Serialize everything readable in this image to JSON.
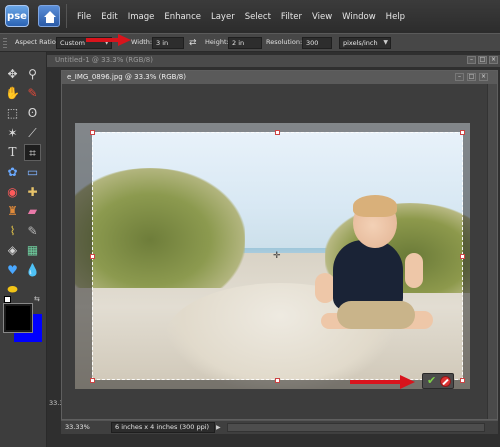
{
  "app": {
    "logo_text": "pse",
    "menu": [
      "File",
      "Edit",
      "Image",
      "Enhance",
      "Layer",
      "Select",
      "Filter",
      "View",
      "Window",
      "Help"
    ]
  },
  "options_bar": {
    "aspect_label": "Aspect Ratio:",
    "aspect_value": "Custom",
    "width_label": "Width:",
    "width_value": "3 in",
    "height_label": "Height:",
    "height_value": "2 in",
    "resolution_label": "Resolution:",
    "resolution_value": "300",
    "resolution_unit": "pixels/inch"
  },
  "background_document": {
    "title": "Untitled-1 @ 33.3% (RGB/8)",
    "zoom": "33.3"
  },
  "document": {
    "title": "e_IMG_0896.jpg @ 33.3% (RGB/8)",
    "zoom": "33.33%",
    "doc_info": "6 inches x 4 inches (300 ppi)"
  },
  "colors": {
    "foreground": "#000000",
    "background": "#0000ff",
    "annotation_arrow": "#d8141c",
    "commit": "#7fd14a",
    "cancel": "#dd3333"
  },
  "icons": {
    "tools": [
      "move-icon",
      "zoom-icon",
      "hand-icon",
      "eyedropper-icon",
      "marquee-icon",
      "lasso-icon",
      "magic-wand-icon",
      "selection-brush-icon",
      "type-icon",
      "crop-icon",
      "cookie-cutter-icon",
      "straighten-icon",
      "red-eye-icon",
      "healing-brush-icon",
      "clone-stamp-icon",
      "eraser-icon",
      "brush-icon",
      "smart-brush-icon",
      "paint-bucket-icon",
      "gradient-icon",
      "shape-icon",
      "blur-icon",
      "sponge-icon"
    ]
  }
}
